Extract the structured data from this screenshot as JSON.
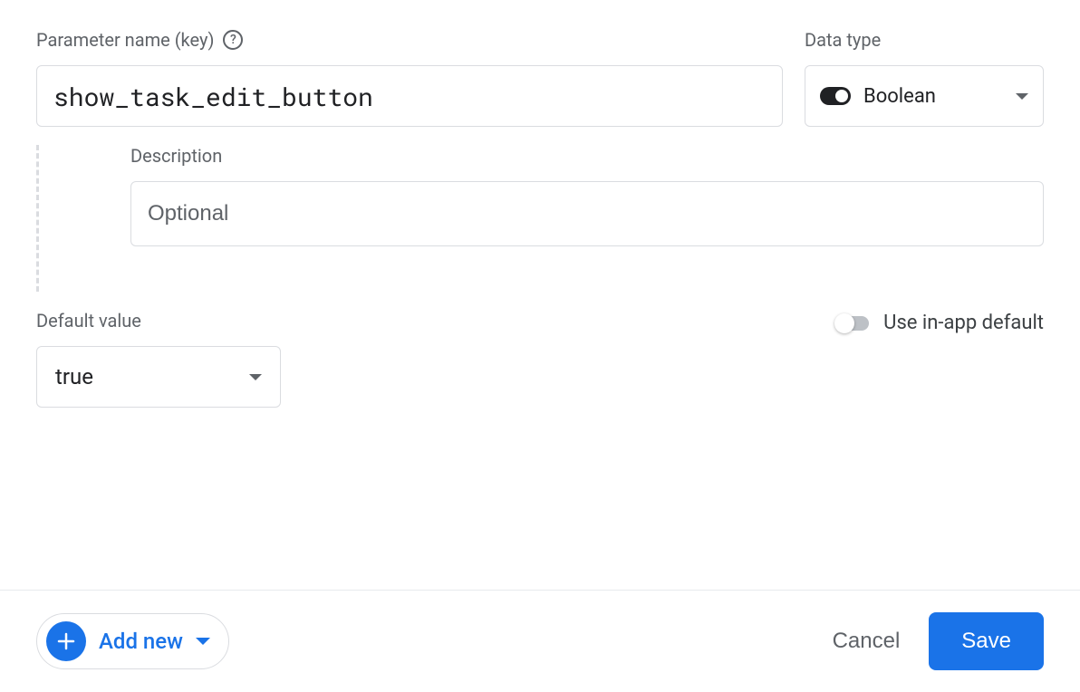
{
  "param_name": {
    "label": "Parameter name (key)",
    "value": "show_task_edit_button"
  },
  "data_type": {
    "label": "Data type",
    "value": "Boolean"
  },
  "description": {
    "label": "Description",
    "placeholder": "Optional",
    "value": ""
  },
  "default_value": {
    "label": "Default value",
    "value": "true"
  },
  "use_in_app": {
    "label": "Use in-app default",
    "enabled": false
  },
  "footer": {
    "add_new": "Add new",
    "cancel": "Cancel",
    "save": "Save"
  }
}
